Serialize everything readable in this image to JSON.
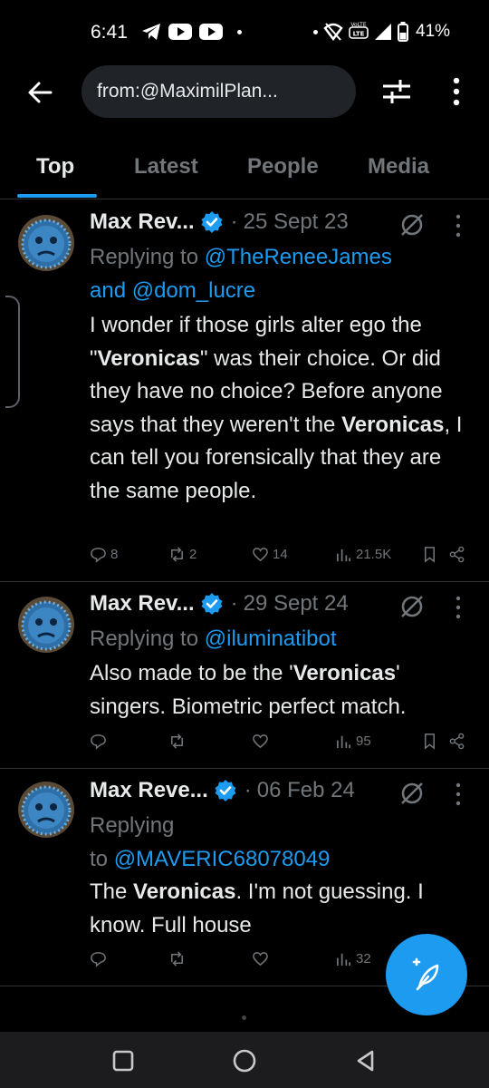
{
  "status_bar": {
    "time": "6:41",
    "battery": "41%"
  },
  "search": {
    "query": "from:@MaximilPlan..."
  },
  "tabs": [
    {
      "label": "Top",
      "active": true
    },
    {
      "label": "Latest",
      "active": false
    },
    {
      "label": "People",
      "active": false
    },
    {
      "label": "Media",
      "active": false
    }
  ],
  "posts": [
    {
      "author": "Max Rev...",
      "date": "25 Sept 23",
      "replying_prefix": "Replying to",
      "mentions": [
        "@TheReneeJames",
        "@dom_lucre"
      ],
      "mention_joiner": "and",
      "body_parts": [
        {
          "text": "I wonder if those girls alter ego the \"",
          "bold": false
        },
        {
          "text": "Veronicas",
          "bold": true
        },
        {
          "text": "\" was their choice. Or did they have no choice? Before anyone says that they weren't the ",
          "bold": false
        },
        {
          "text": "Veronicas",
          "bold": true
        },
        {
          "text": ", I can tell you forensically that they are the same people.",
          "bold": false
        }
      ],
      "actions": {
        "replies": "8",
        "reposts": "2",
        "likes": "14",
        "views": "21.5K"
      }
    },
    {
      "author": "Max Rev...",
      "date": "29 Sept 24",
      "replying_prefix": "Replying to",
      "mentions": [
        "@iluminatibot"
      ],
      "body_parts": [
        {
          "text": "Also made to be the '",
          "bold": false
        },
        {
          "text": "Veronicas",
          "bold": true
        },
        {
          "text": "' singers. Biometric perfect match.",
          "bold": false
        }
      ],
      "actions": {
        "replies": "",
        "reposts": "",
        "likes": "",
        "views": "95"
      }
    },
    {
      "author": "Max Reve...",
      "date": "06 Feb 24",
      "replying_prefix": "Replying",
      "replying_to": "to",
      "mentions": [
        "@MAVERIC68078049"
      ],
      "body_parts": [
        {
          "text": "The ",
          "bold": false
        },
        {
          "text": "Veronicas",
          "bold": true
        },
        {
          "text": ". I'm not guessing. I know. Full house",
          "bold": false
        }
      ],
      "actions": {
        "replies": "",
        "reposts": "",
        "likes": "",
        "views": "32"
      }
    }
  ],
  "separator": "·",
  "colors": {
    "background": "#000000",
    "accent": "#1d9bf0",
    "muted": "#71767b",
    "text": "#e7e9ea",
    "search_bg": "#202327"
  },
  "icons": {
    "back": "arrow-left-icon",
    "filter": "sliders-icon",
    "more": "more-vertical-icon",
    "verified": "verified-badge-icon",
    "grok": "grok-icon",
    "compose": "compose-feather-icon"
  }
}
